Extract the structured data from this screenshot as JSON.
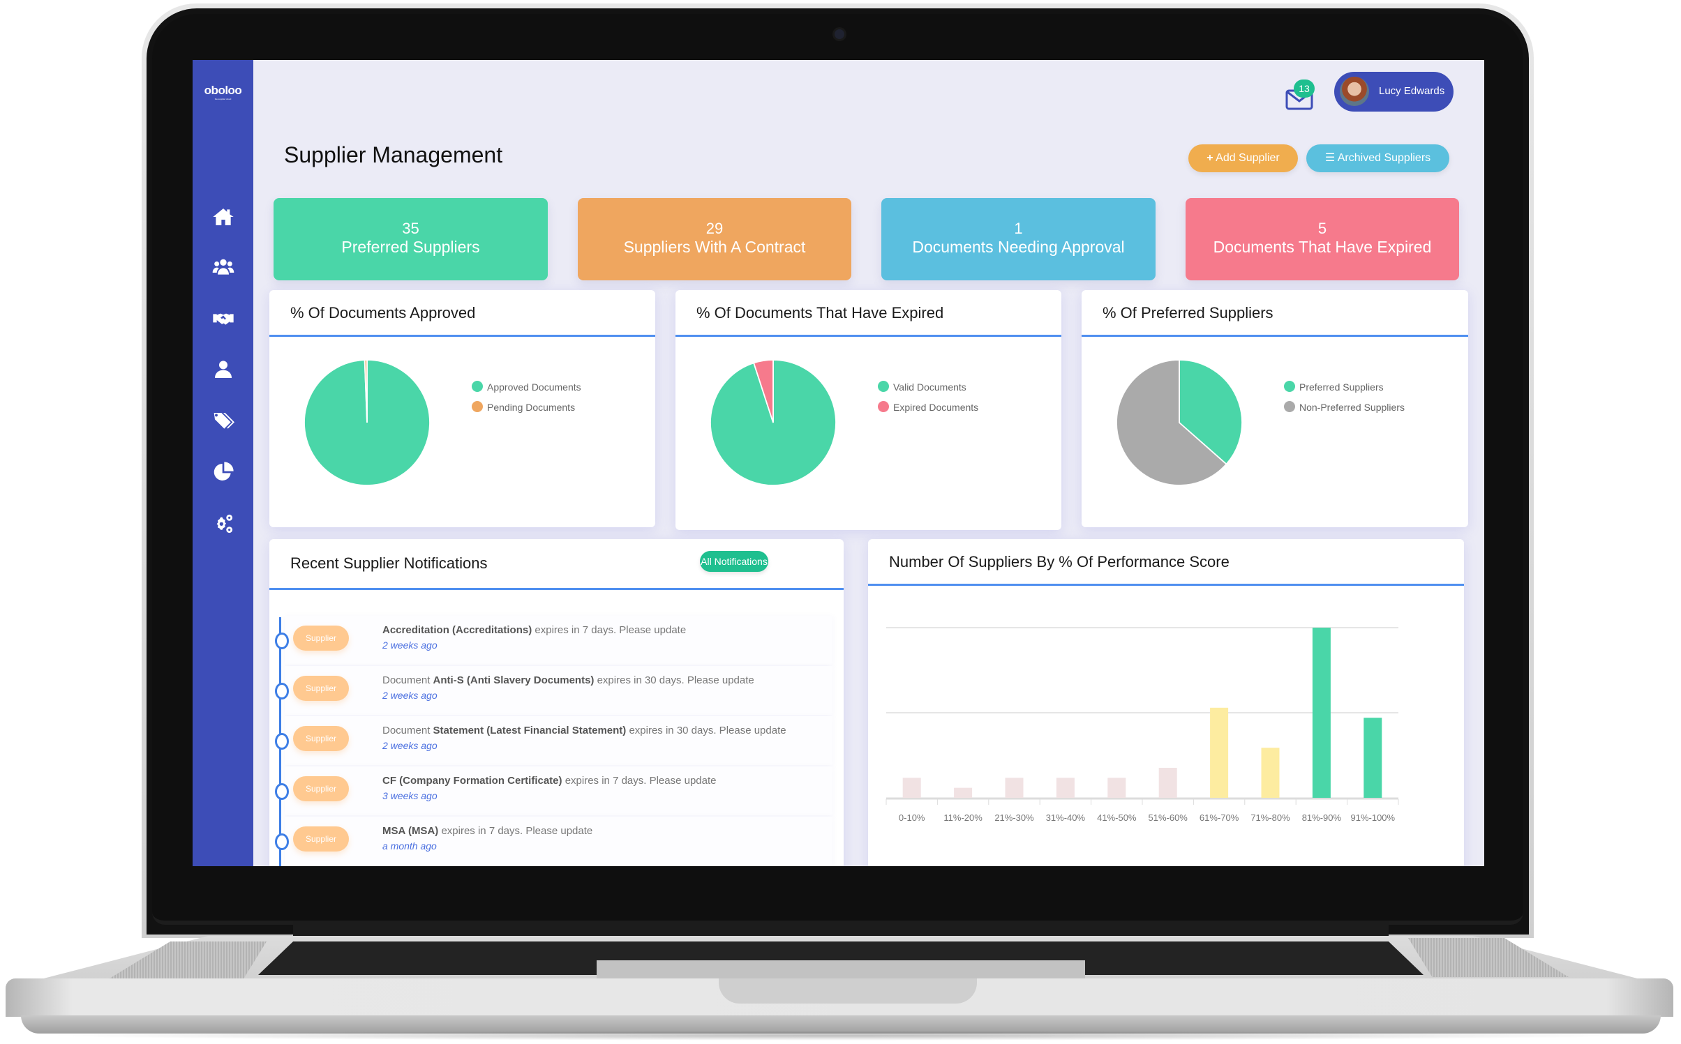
{
  "app": {
    "logo": "oboloo",
    "logo_tagline": "the supplier cloud"
  },
  "header": {
    "mail_badge_count": "13",
    "user_name": "Lucy Edwards"
  },
  "page": {
    "title": "Supplier Management",
    "add_supplier_label": "Add Supplier",
    "archived_suppliers_label": "Archived Suppliers"
  },
  "sidebar": {
    "items": [
      {
        "icon": "home-icon"
      },
      {
        "icon": "users-icon"
      },
      {
        "icon": "handshake-icon"
      },
      {
        "icon": "user-icon"
      },
      {
        "icon": "tags-icon"
      },
      {
        "icon": "pie-chart-icon"
      },
      {
        "icon": "gears-icon"
      }
    ]
  },
  "stats": [
    {
      "value": "35",
      "label": "Preferred Suppliers",
      "color": "#4ad6a8"
    },
    {
      "value": "29",
      "label": "Suppliers With A Contract",
      "color": "#efa65f"
    },
    {
      "value": "1",
      "label": "Documents Needing Approval",
      "color": "#5bbfdf"
    },
    {
      "value": "5",
      "label": "Documents That Have Expired",
      "color": "#f67a8c"
    }
  ],
  "notifications": {
    "title": "Recent Supplier Notifications",
    "all_label": "All Notifications",
    "items": [
      {
        "tag": "Supplier",
        "prefix": "",
        "bold": "Accreditation (Accreditations)",
        "suffix": " expires in 7 days. Please update",
        "time": "2 weeks ago"
      },
      {
        "tag": "Supplier",
        "prefix": "Document ",
        "bold": "Anti-S (Anti Slavery Documents)",
        "suffix": " expires in 30 days. Please update",
        "time": "2 weeks ago"
      },
      {
        "tag": "Supplier",
        "prefix": "Document ",
        "bold": "Statement (Latest Financial Statement)",
        "suffix": " expires in 30 days. Please update",
        "time": "2 weeks ago"
      },
      {
        "tag": "Supplier",
        "prefix": "",
        "bold": "CF (Company Formation Certificate)",
        "suffix": " expires in 7 days. Please update",
        "time": "3 weeks ago"
      },
      {
        "tag": "Supplier",
        "prefix": "",
        "bold": "MSA (MSA)",
        "suffix": " expires in 7 days. Please update",
        "time": "a month ago"
      }
    ]
  },
  "chart_data": [
    {
      "type": "pie",
      "title": "% Of Documents Approved",
      "labels": [
        "Approved Documents",
        "Pending Documents"
      ],
      "values": [
        99.4,
        0.6
      ],
      "colors": [
        "#4ad6a8",
        "#efa65f"
      ],
      "legend": "right"
    },
    {
      "type": "pie",
      "title": "% Of Documents That Have Expired",
      "labels": [
        "Valid Documents",
        "Expired Documents"
      ],
      "values": [
        95,
        5
      ],
      "colors": [
        "#4ad6a8",
        "#f67a8c"
      ],
      "legend": "right"
    },
    {
      "type": "pie",
      "title": "% Of Preferred Suppliers",
      "labels": [
        "Preferred Suppliers",
        "Non-Preferred Suppliers"
      ],
      "values": [
        36.5,
        63.5
      ],
      "colors": [
        "#4ad6a8",
        "#aaaaaa"
      ],
      "legend": "right"
    },
    {
      "type": "bar",
      "title": "Number Of Suppliers By % Of Performance Score",
      "categories": [
        "0-10%",
        "11%-20%",
        "21%-30%",
        "31%-40%",
        "41%-50%",
        "51%-60%",
        "61%-70%",
        "71%-80%",
        "81%-90%",
        "91%-100%"
      ],
      "values": [
        2,
        1,
        2,
        2,
        2,
        3,
        9,
        5,
        17,
        8
      ],
      "colors": [
        "#f1e2e3",
        "#f1e2e3",
        "#f1e2e3",
        "#f1e2e3",
        "#f1e2e3",
        "#f1e2e3",
        "#fdeca0",
        "#fdeca0",
        "#4ad6a8",
        "#4ad6a8"
      ],
      "xlabel": "",
      "ylabel": "",
      "ylim": [
        0,
        17
      ],
      "gridlines": [
        8.5,
        17
      ],
      "grid": true,
      "legend": "none"
    }
  ]
}
